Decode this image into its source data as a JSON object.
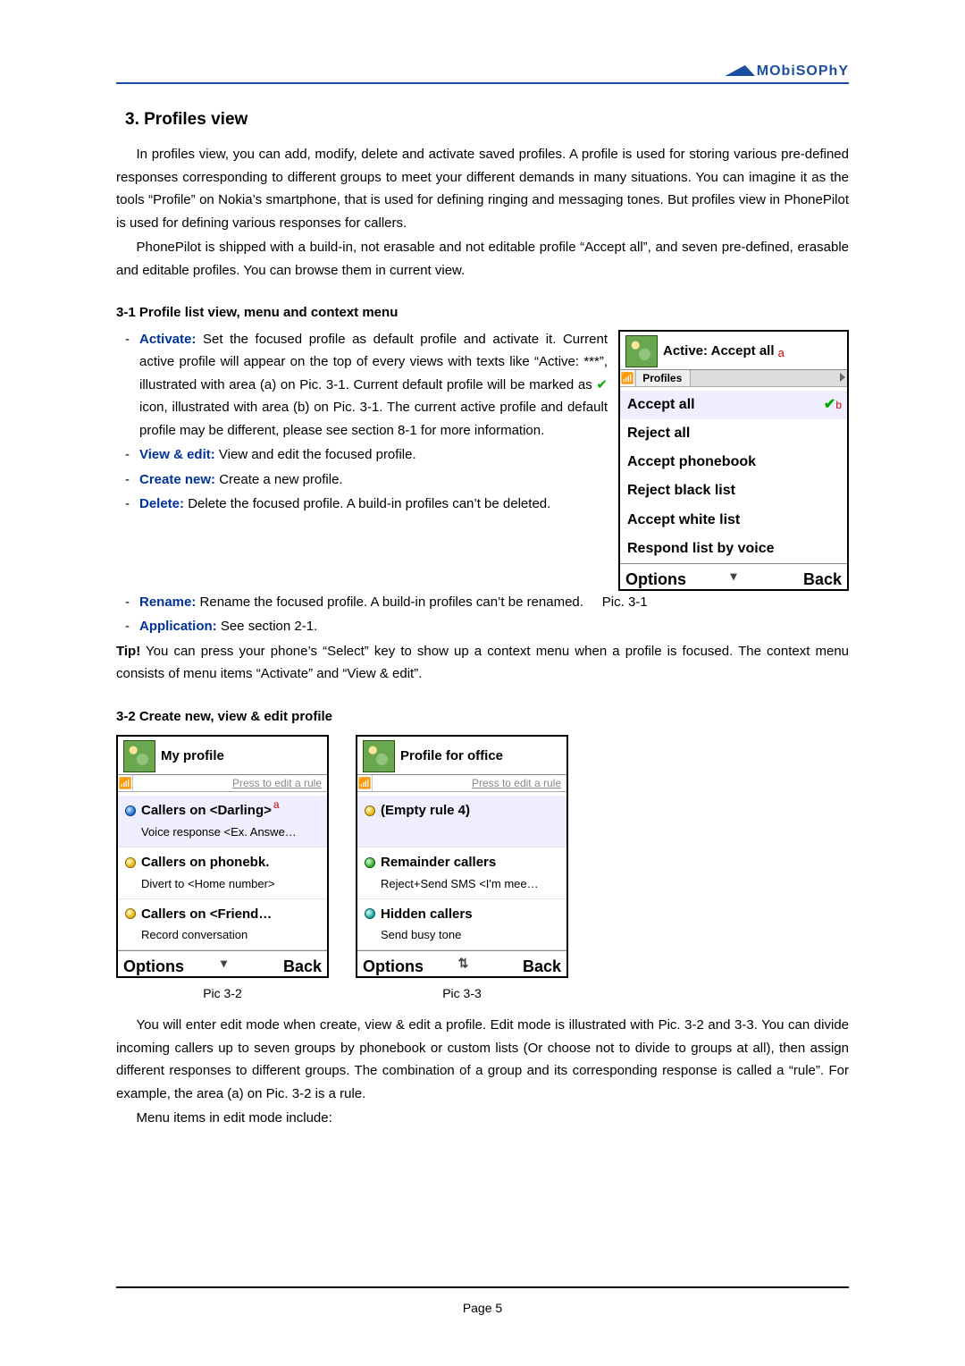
{
  "brand": "MObiSOPhY",
  "heading": "3. Profiles view",
  "para1": "In profiles view, you can add, modify, delete and activate saved profiles. A profile is used for storing various pre-defined responses corresponding to different groups to meet your different demands in many situations. You can imagine it as the tools “Profile” on Nokia’s smartphone, that is used for defining ringing and messaging tones. But profiles view in PhonePilot is used for defining various responses for callers.",
  "para2": "PhonePilot is shipped with a build-in, not erasable and not editable profile “Accept all”, and seven pre-defined, erasable and editable profiles. You can browse them in current view.",
  "sub31": "3-1 Profile list view, menu and context menu",
  "menu31": {
    "activate": {
      "label": "Activate:",
      "text": " Set the focused profile as default profile and activate it. Current active profile will appear on the top of every views with texts like “Active: ***”, illustrated with area (a) on Pic. 3-1. Current default profile will be marked as ",
      "text2": " icon, illustrated with area (b) on Pic. 3-1. The current active profile and default profile may be different, please see section 8-1 for more information."
    },
    "view": {
      "label": "View & edit:",
      "text": " View and edit the focused profile."
    },
    "create": {
      "label": "Create new:",
      "text": " Create a new profile."
    },
    "delete": {
      "label": "Delete:",
      "text": " Delete the focused profile. A build-in profiles can’t be deleted."
    },
    "rename": {
      "label": "Rename:",
      "text": " Rename the focused profile. A build-in profiles can’t be renamed.",
      "piclabel": "Pic. 3-1"
    },
    "app": {
      "label": "Application:",
      "text": " See section 2-1."
    }
  },
  "tip": {
    "label": "Tip!",
    "text": " You can press your phone’s “Select” key to show up a context menu when a profile is focused. The context menu consists of menu items “Activate” and “View & edit”."
  },
  "pic31": {
    "headerTitle": "Active: Accept all",
    "a": "a",
    "tabLabel": "Profiles",
    "rows": [
      "Accept all",
      "Reject all",
      "Accept phonebook",
      "Reject black list",
      "Accept white list",
      "Respond list by voice"
    ],
    "b": "b",
    "softLeft": "Options",
    "softRight": "Back"
  },
  "sub32": "3-2 Create new, view & edit profile",
  "pic32": {
    "title": "My profile",
    "hint": "Press to edit a rule",
    "r1t": "Callers on <Darling>",
    "r1a": "a",
    "r1d": "Voice response <Ex. Answe…",
    "r2t": "Callers on phonebk.",
    "r2d": "Divert to <Home number>",
    "r3t": "Callers on <Friend…",
    "r3d": "Record conversation",
    "softLeft": "Options",
    "softRight": "Back",
    "cap": "Pic 3-2"
  },
  "pic33": {
    "title": "Profile for office",
    "hint": "Press to edit a rule",
    "r1t": "(Empty rule 4)",
    "r2t": "Remainder callers",
    "r2d": "Reject+Send SMS <I'm mee…",
    "r3t": "Hidden callers",
    "r3d": "Send busy tone",
    "softLeft": "Options",
    "softRight": "Back",
    "cap": "Pic 3-3"
  },
  "para3": "You will enter edit mode when create, view & edit a profile. Edit mode is illustrated with Pic. 3-2 and 3-3. You can divide incoming callers up to seven groups by phonebook or custom lists (Or choose not to divide to groups at all), then assign different responses to different groups. The combination of a group and its corresponding response is called a “rule”. For example, the area (a) on Pic. 3-2 is a rule.",
  "para4": "Menu items in edit mode include:",
  "pagenum": "Page 5"
}
